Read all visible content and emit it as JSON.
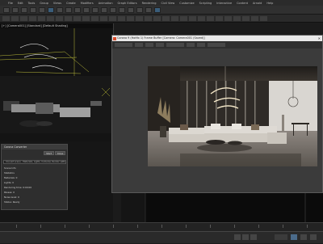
{
  "menu": [
    "File",
    "Edit",
    "Tools",
    "Group",
    "Views",
    "Create",
    "Modifiers",
    "Animation",
    "Graph Editors",
    "Rendering",
    "Civil View",
    "Customize",
    "Scripting",
    "Interactive",
    "Content",
    "Arnold",
    "Help"
  ],
  "viewport": {
    "label": "[+] [Camera001] [Standard] [Default Shading]"
  },
  "dialog": {
    "title": "Corona Converter",
    "btn1": "Start",
    "btn2": "Close",
    "field": "Convert scene - Materials, Lights, Cameras, Render settings",
    "lines": [
      "Scene Info",
      "Statistics",
      "Materials: 0",
      "Lights: 0",
      "Rendering time: 0:00:00",
      "Passes: 0",
      "Noise level: 0",
      "Status: Ready"
    ]
  },
  "render_window": {
    "title": "Corona 9 (Hotfix 1) Frame Buffer [Camera: Camera001 (Saved)]",
    "close": "✕"
  },
  "colors": {
    "accent": "#d94b2b",
    "title_bar": "#e9e9e9",
    "window": "#3b3b3b"
  }
}
